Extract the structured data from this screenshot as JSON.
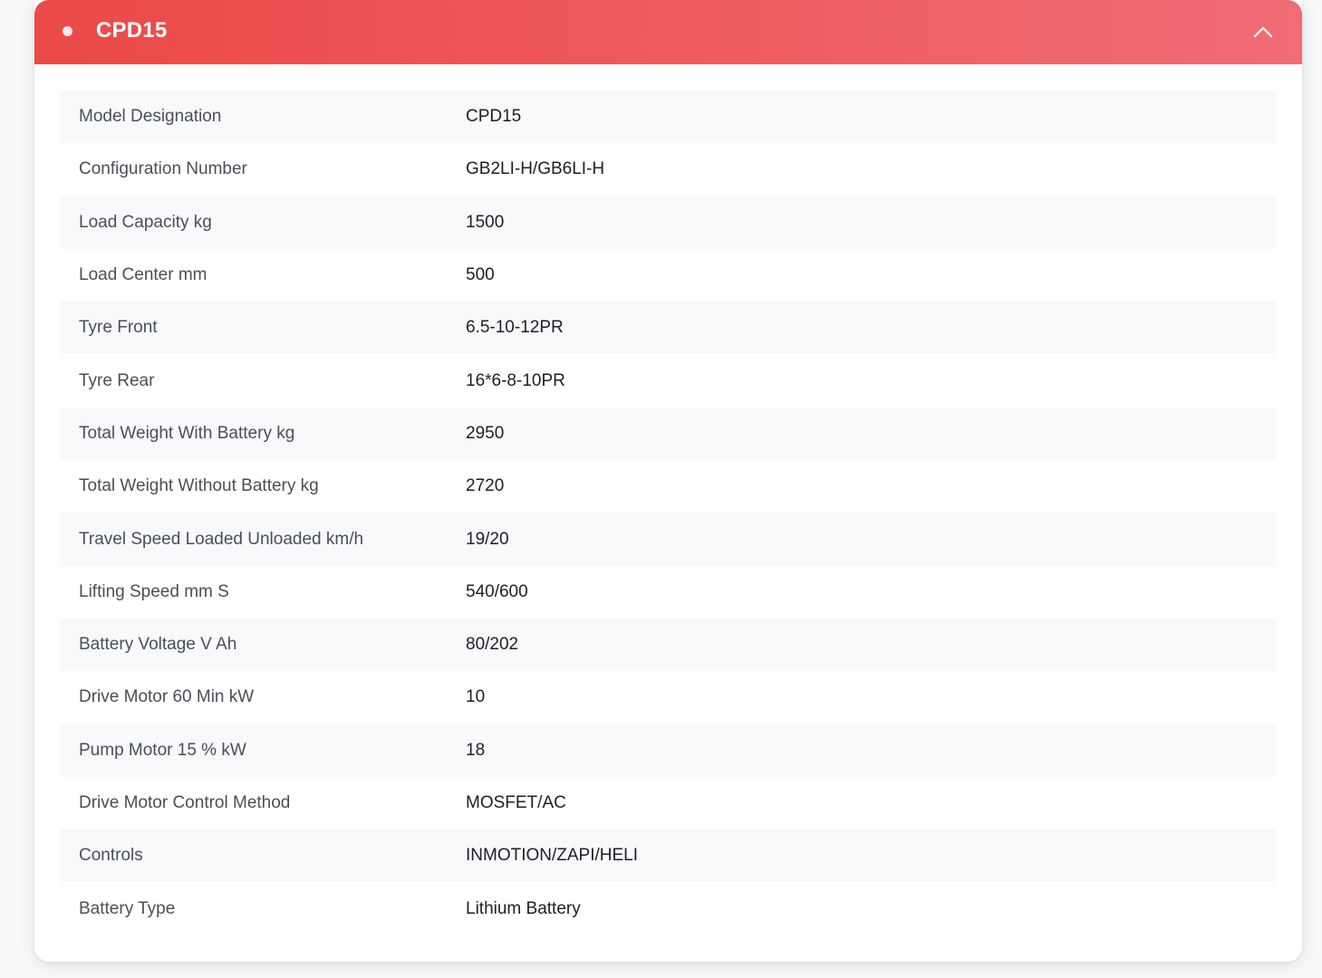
{
  "panel": {
    "title": "CPD15",
    "colors": {
      "header_start": "#ea4a48",
      "header_end": "#f06c76",
      "row_stripe": "#f8f9fb",
      "label_text": "#4a4f57",
      "value_text": "#1c1f24"
    },
    "icons": {
      "bullet": "dot-icon",
      "toggle": "chevron-up-icon"
    }
  },
  "specs": [
    {
      "label": "Model Designation",
      "value": "CPD15"
    },
    {
      "label": "Configuration Number",
      "value": "GB2LI-H/GB6LI-H"
    },
    {
      "label": "Load Capacity kg",
      "value": "1500"
    },
    {
      "label": "Load Center mm",
      "value": "500"
    },
    {
      "label": "Tyre Front",
      "value": "6.5-10-12PR"
    },
    {
      "label": "Tyre Rear",
      "value": "16*6-8-10PR"
    },
    {
      "label": "Total Weight With Battery kg",
      "value": "2950"
    },
    {
      "label": "Total Weight Without Battery kg",
      "value": "2720"
    },
    {
      "label": "Travel Speed Loaded Unloaded km/h",
      "value": "19/20"
    },
    {
      "label": "Lifting Speed mm S",
      "value": "540/600"
    },
    {
      "label": "Battery Voltage V Ah",
      "value": "80/202"
    },
    {
      "label": "Drive Motor 60 Min kW",
      "value": "10"
    },
    {
      "label": "Pump Motor 15 % kW",
      "value": "18"
    },
    {
      "label": "Drive Motor Control Method",
      "value": "MOSFET/AC"
    },
    {
      "label": "Controls",
      "value": "INMOTION/ZAPI/HELI"
    },
    {
      "label": "Battery Type",
      "value": "Lithium Battery"
    }
  ]
}
